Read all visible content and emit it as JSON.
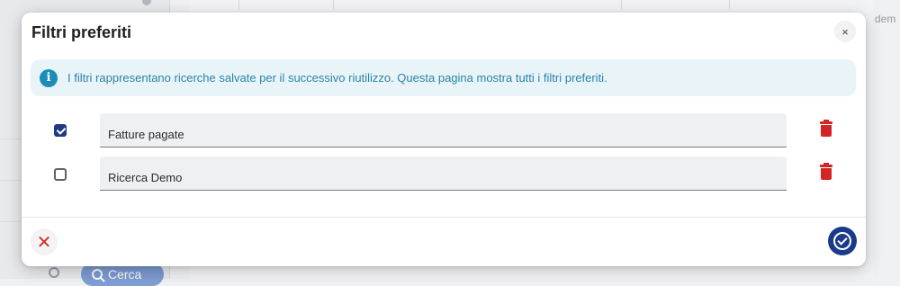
{
  "background": {
    "right_text": "dem",
    "search_button_label": "Cerca"
  },
  "dialog": {
    "title": "Filtri preferiti",
    "close_label": "×",
    "info_text": "I filtri rappresentano ricerche salvate per il successivo riutilizzo. Questa pagina mostra tutti i filtri preferiti.",
    "filters": [
      {
        "name": "Fatture pagate",
        "checked": true
      },
      {
        "name": "Ricerca Demo",
        "checked": false
      }
    ],
    "cancel_label": "✕",
    "colors": {
      "primary": "#1a3a8c",
      "danger": "#d32525",
      "info": "#1b8db8"
    }
  }
}
